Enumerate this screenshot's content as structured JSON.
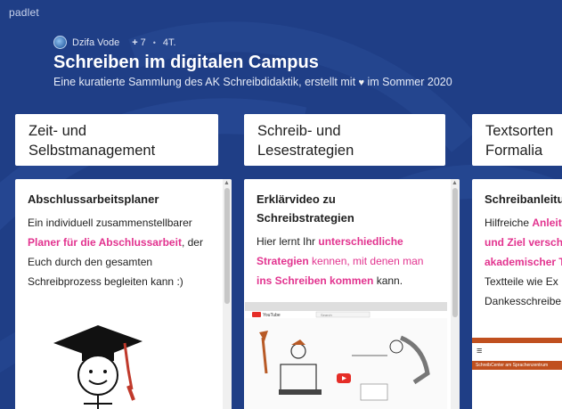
{
  "brand": "padlet",
  "meta": {
    "author": "Dzifa Vode",
    "plus": "+",
    "contributors": "7",
    "dot": "•",
    "age": "4T."
  },
  "title": "Schreiben im digitalen Campus",
  "subtitle": {
    "before": "Eine kuratierte Sammlung des AK Schreibdidaktik, erstellt mit ",
    "heart": "♥",
    "after": " im Sommer 2020"
  },
  "columns": [
    {
      "line1": "Zeit- und",
      "line2": "Selbstmanagement"
    },
    {
      "line1": "Schreib- und",
      "line2": "Lesestrategien"
    },
    {
      "line1": "Textsorten",
      "line2": "Formalia"
    }
  ],
  "cards": [
    {
      "title": "Abschlussarbeitsplaner",
      "text1": "Ein individuell zusammenstellbarer",
      "link": "Planer für die Abschlussarbeit",
      "text2": ", der",
      "text3": "Euch durch den gesamten",
      "text4": "Schreibprozess begleiten kann :)"
    },
    {
      "title_line1": "Erklärvideo zu",
      "title_line2": "Schreibstrategien",
      "text1": "Hier lernt Ihr ",
      "link1": "unterschiedliche",
      "link2": "Strategien",
      "mid": " kennen, mit denen man",
      "link3": "ins Schreiben kommen",
      "end": " kann.",
      "video_logo": "YouTube",
      "video_search": "Search"
    },
    {
      "title": "Schreibanleitu",
      "text1": "Hilfreiche ",
      "link1": "Anleit",
      "link2": "und Ziel versch",
      "link3": "akademischer T",
      "text2": "Textteile wie Ex",
      "text3": "Dankesschreibe",
      "thumb_menu": "≡",
      "thumb_banner": "SchreibCenter am Sprachenzentrum"
    }
  ],
  "colors": {
    "background": "#1f3e86",
    "accent": "#e2338f"
  }
}
